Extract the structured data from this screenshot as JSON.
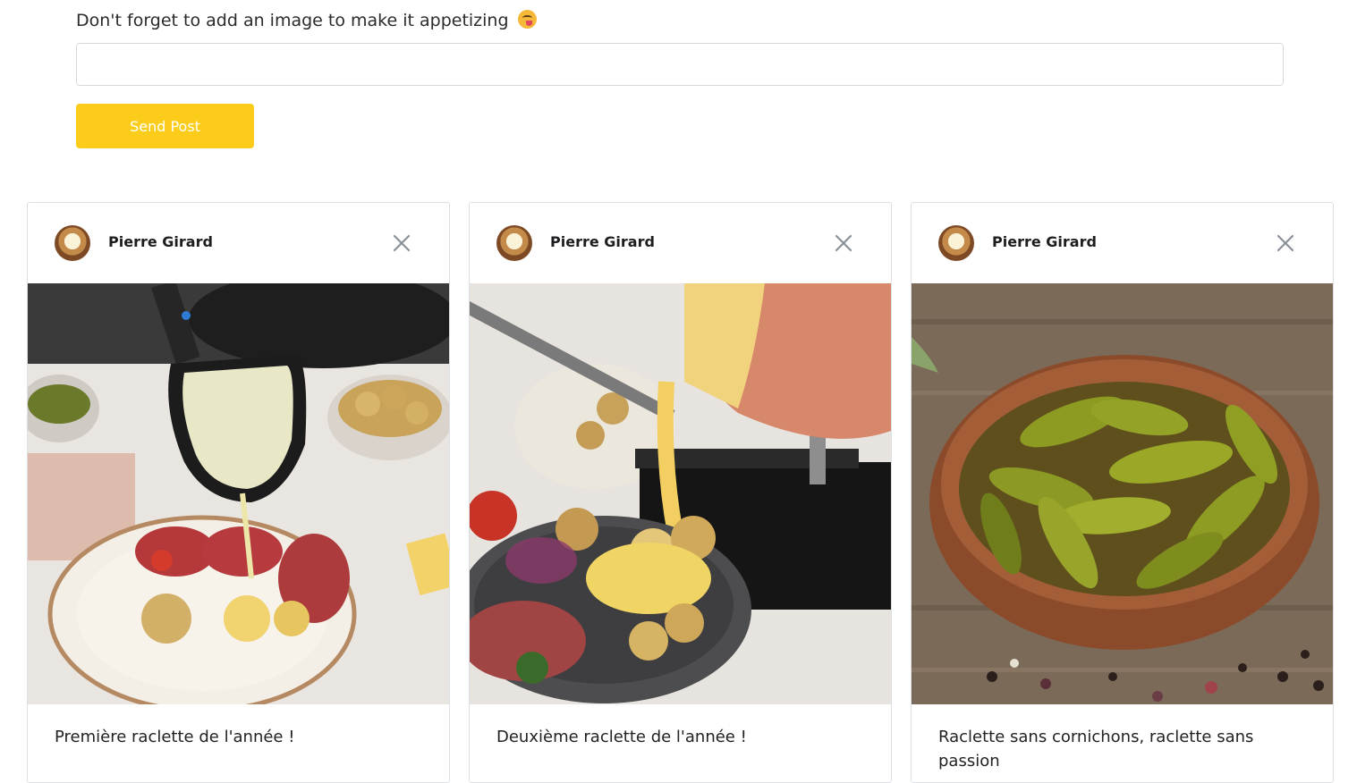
{
  "form": {
    "hint": "Don't forget to add an image to make it appetizing",
    "hint_emoji_icon": "face-savoring-food-icon",
    "image_input_value": "",
    "image_input_placeholder": "",
    "send_label": "Send Post"
  },
  "colors": {
    "accent": "#fbcd1a",
    "border": "#dcdfe3",
    "close_icon": "#8a8f98"
  },
  "posts": [
    {
      "author": "Pierre Girard",
      "avatar_icon": "raclette-avatar",
      "close_icon": "close-icon",
      "image_subject": "raclette-pan-with-charcuterie",
      "text": "Première raclette de l'année !"
    },
    {
      "author": "Pierre Girard",
      "avatar_icon": "raclette-avatar",
      "close_icon": "close-icon",
      "image_subject": "melting-raclette-wheel",
      "text": "Deuxième raclette de l'année !"
    },
    {
      "author": "Pierre Girard",
      "avatar_icon": "raclette-avatar",
      "close_icon": "close-icon",
      "image_subject": "bowl-of-gherkins",
      "text": "Raclette sans cornichons, raclette sans passion"
    }
  ]
}
